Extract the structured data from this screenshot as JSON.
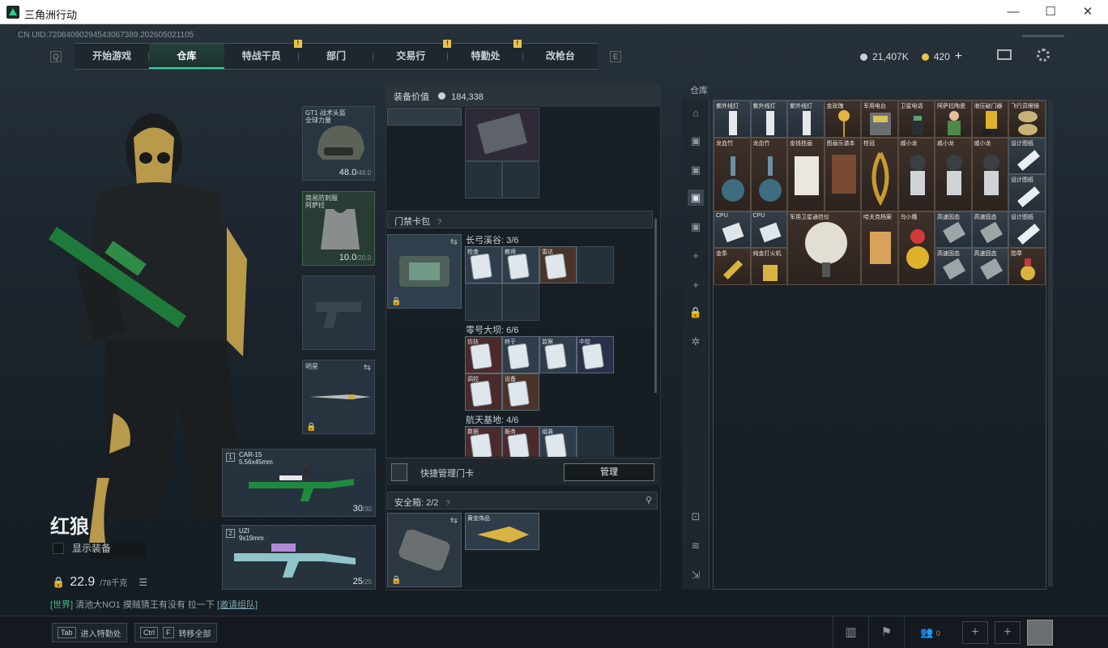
{
  "window": {
    "title": "三角洲行动",
    "minimize": "—",
    "maximize": "☐",
    "close": "✕"
  },
  "uid": "CN UID:72084090294543067389.202605021105",
  "nav": {
    "left_key": "Q",
    "right_key": "E",
    "tabs": [
      "开始游戏",
      "仓库",
      "特战干员",
      "部门",
      "交易行",
      "特勤处",
      "改枪台"
    ],
    "active": "仓库",
    "badges": [
      "!",
      "!",
      "!"
    ]
  },
  "currency": {
    "coins": "21,407K",
    "gold": "420",
    "plus": "+"
  },
  "character": {
    "name": "红狼",
    "show_equip": "显示装备",
    "weight": "22.9",
    "weight_max": "/78千克",
    "chat_channel": "[世界]",
    "chat_text": "清池大NO1 摸贼猜王有没有 拉一下",
    "chat_link": "[邀请组队]"
  },
  "equipment": {
    "helmet": {
      "label": "GT1 战术头盔",
      "sub": "全球力量",
      "dur": "48.0",
      "max": "/48.0"
    },
    "armor": {
      "label": "简易防刺服",
      "sub": "阿萨拉",
      "dur": "10.0",
      "max": "/20.0"
    },
    "melee": {
      "label": "明星"
    },
    "primary": {
      "slot": "1",
      "name": "CAR-15",
      "ammo": "5.56x45mm",
      "count": "30",
      "max": "/30"
    },
    "secondary": {
      "slot": "2",
      "name": "UZI",
      "ammo": "9x19mm",
      "count": "25",
      "max": "/25"
    }
  },
  "middle": {
    "value_label": "装备价值",
    "value": "184,338",
    "keycard_title": "门禁卡包",
    "help": "?",
    "maps": [
      {
        "name": "长弓溪谷: 3/6",
        "cards": [
          "检查",
          "教师",
          "雷达"
        ]
      },
      {
        "name": "零号大坝: 6/6",
        "cards": [
          "仿扶",
          "终于",
          "监察",
          "中控",
          "调控",
          "设备"
        ]
      },
      {
        "name": "航天基地: 4/6",
        "cards": [
          "数据",
          "服务",
          "组装"
        ]
      }
    ],
    "quick_manage": "快捷管理门卡",
    "manage_btn": "管理",
    "safebox_label": "安全箱: 2/2",
    "pin": "⚲",
    "safe_item": "黄金饰品"
  },
  "warehouse": {
    "title": "仓库",
    "items": [
      "紫外线灯",
      "紫外线灯",
      "紫外线灯",
      "金玫瑰",
      "军用电台",
      "卫星电话",
      "阿萨拉陶瓷",
      "液压破门器",
      "飞行员眼镜",
      "龙血竹",
      "龙血竹",
      "金钱挂画",
      "图画乐谱本",
      "桂冠",
      "戚小龙",
      "戚小龙",
      "戚小龙",
      "设计图纸",
      "设计图纸",
      "CPU",
      "CPU",
      "军用卫星通信仪",
      "哈夫克档案",
      "乌小鹰",
      "高速固态",
      "高速固态",
      "设计图纸",
      "金条",
      "纯金打火机",
      "高速固态",
      "高速固态",
      "勋章"
    ]
  },
  "bottom": {
    "tab_key": "Tab",
    "tab_label": "进入特勤处",
    "ctrl_key": "Ctrl",
    "f_key": "F",
    "transfer_label": "转移全部",
    "friends": "0"
  },
  "colors": {
    "accent": "#2fd2a0",
    "gold": "#e9c44d"
  }
}
